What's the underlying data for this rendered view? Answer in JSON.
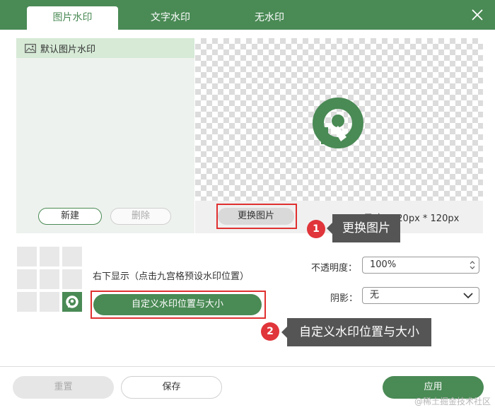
{
  "colors": {
    "accent": "#4a8a55",
    "highlight": "#e03030",
    "badge": "#e0353a",
    "callout_bg": "#555555"
  },
  "tabs": [
    {
      "label": "图片水印",
      "active": true
    },
    {
      "label": "文字水印",
      "active": false
    },
    {
      "label": "无水印",
      "active": false
    }
  ],
  "close_icon": "close-icon",
  "list": {
    "items": [
      {
        "icon": "image-icon",
        "label": "默认图片水印",
        "selected": true
      }
    ],
    "new_label": "新建",
    "delete_label": "删除"
  },
  "preview": {
    "logo_icon": "logo-icon",
    "change_label": "更换图片",
    "size_text": "尺寸：120px * 120px"
  },
  "annotations": [
    {
      "number": "1",
      "text": "更换图片"
    },
    {
      "number": "2",
      "text": "自定义水印位置与大小"
    }
  ],
  "grid": {
    "caption": "右下显示（点击九宫格预设水印位置）",
    "active_cell": 8
  },
  "custom_button_label": "自定义水印位置与大小",
  "form": {
    "opacity_label": "不透明度：",
    "opacity_value": "100%",
    "shadow_label": "阴影：",
    "shadow_value": "无"
  },
  "footer": {
    "reset_label": "重置",
    "save_label": "保存",
    "apply_label": "应用"
  },
  "watermark_text": "@稀土掘金技术社区"
}
